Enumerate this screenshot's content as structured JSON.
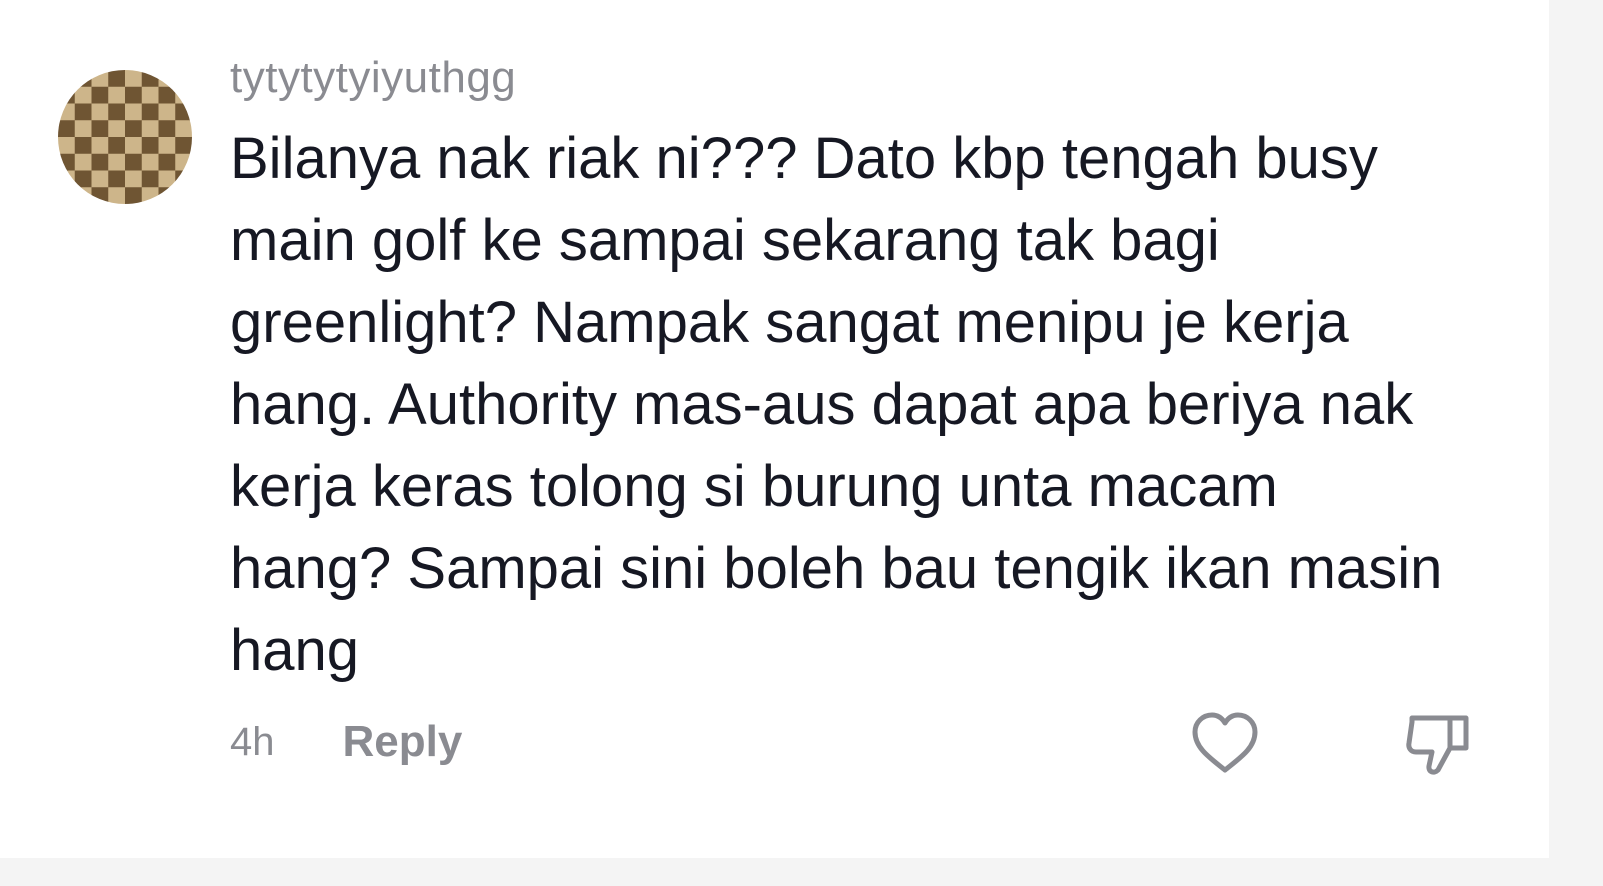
{
  "comment": {
    "username": "tytytytyiyuthgg",
    "text": "Bilanya nak riak ni??? Dato kbp tengah busy main golf ke sampai sekarang tak bagi greenlight? Nampak sangat menipu je kerja hang. Authority mas-aus dapat apa beriya nak kerja keras tolong si burung unta macam hang? Sampai sini boleh bau tengik ikan masin hang",
    "timestamp": "4h",
    "reply_label": "Reply",
    "avatar_icon": "checkerboard-avatar-icon",
    "like_icon": "heart-outline-icon",
    "dislike_icon": "thumbs-down-outline-icon"
  },
  "colors": {
    "text_primary": "#161823",
    "text_secondary": "#8a8b91",
    "avatar_light": "#cdb58a",
    "avatar_dark": "#6f5533"
  }
}
